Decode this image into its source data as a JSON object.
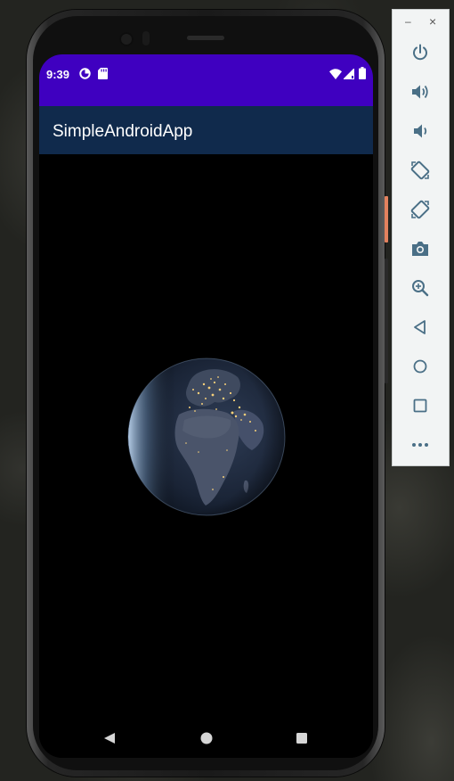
{
  "status_bar": {
    "time": "9:39",
    "background": "#3f00c0",
    "left_icons": [
      "data-saver-icon",
      "sd-card-icon"
    ],
    "right_icons": [
      "wifi-icon",
      "cell-signal-icon",
      "battery-icon"
    ]
  },
  "app_bar": {
    "title": "SimpleAndroidApp",
    "background": "#102a4c"
  },
  "content": {
    "image": "earth-at-night-icon",
    "background": "#000000"
  },
  "nav_bar": {
    "buttons": [
      "back-icon",
      "home-icon",
      "recents-icon"
    ]
  },
  "emulator_toolbar": {
    "window_controls": [
      "minimize-icon",
      "close-icon"
    ],
    "minimize_glyph": "–",
    "close_glyph": "×",
    "buttons": [
      "power-icon",
      "volume-up-icon",
      "volume-down-icon",
      "rotate-left-icon",
      "rotate-right-icon",
      "screenshot-icon",
      "zoom-icon",
      "back-icon",
      "home-icon",
      "overview-icon",
      "more-icon"
    ],
    "accent": "#4a6f86"
  }
}
